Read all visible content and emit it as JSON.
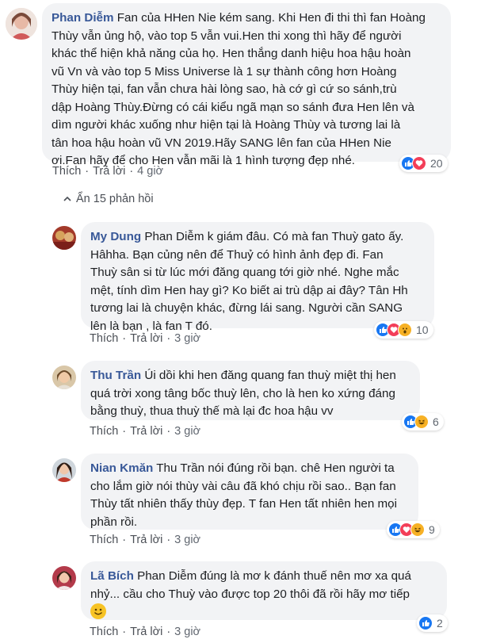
{
  "comments": [
    {
      "author": "Phan Diễm",
      "lines": [
        "Fan của HHen Nie kém sang. Khi Hen đi thi thì fan Hoàng",
        "Thùy vẫn ủng hộ, vào top 5 vẫn vui.Hen thi xong thì hãy để người",
        "khác thể hiện khả năng của họ. Hen thắng danh hiệu hoa hậu hoàn",
        "vũ Vn và vào top 5 Miss Universe là 1 sự thành công hơn Hoàng",
        "Thùy hiện tại, fan vẫn chưa hài lòng sao, hà cớ gì cứ so sánh,trù",
        "dập Hoàng Thùy.Đừng có cái kiểu ngã mạn so sánh đưa Hen lên và",
        "dìm người khác xuống như hiện tại là Hoàng Thùy và tương lai là",
        "tân hoa hậu hoàn vũ VN 2019.Hãy SANG lên fan của HHen Nie",
        "ơi.Fan hãy để cho Hen vẫn mãi là 1 hình tượng đẹp nhé."
      ],
      "like": "Thích",
      "reply": "Trả lời",
      "time": "4 giờ",
      "reaction_count": "20"
    }
  ],
  "replies_toggle": "Ẩn 15 phản hồi",
  "replies": [
    {
      "author": "My Dung",
      "lines": [
        "Phan Diễm k giám đâu. Có mà fan Thuỳ gato ấy.",
        "Hâhha. Bạn củng nên để Thuỷ có hình ảnh đẹp đi. Fan",
        "Thuỳ sân si từ lúc mới đăng quang tới giờ nhé. Nghe mắc",
        "mệt, tính dìm Hen hay gì? Ko biết ai trù dập ai đây? Tân Hh",
        "tương lai là chuyện khác, đừng lái sang. Người cần SANG",
        "lên là bạn , là fan T đó."
      ],
      "like": "Thích",
      "reply": "Trả lời",
      "time": "3 giờ",
      "reaction_count": "10"
    },
    {
      "author": "Thu Trần",
      "lines": [
        "Úi dồi khi hen đăng quang fan thuỳ miệt thị hen",
        "quá trời xong tâng bốc thuỳ lên, cho là hen ko xứng đáng",
        "bằng thuỳ, thua thuỳ thế mà lại đc hoa hậu vv"
      ],
      "like": "Thích",
      "reply": "Trả lời",
      "time": "3 giờ",
      "reaction_count": "6"
    },
    {
      "author": "Nian Kmăn",
      "lines": [
        "Thu Trần nói đúng rồi bạn. chê Hen người ta",
        "cho lắm giờ nói thùy vài câu đã khó chịu rồi sao.. Bạn fan",
        "Thùy tất nhiên thấy thùy đẹp. T fan Hen tất nhiên hen mọi",
        "phần rồi."
      ],
      "like": "Thích",
      "reply": "Trả lời",
      "time": "3 giờ",
      "reaction_count": "9"
    },
    {
      "author": "Lã Bích",
      "lines": [
        "Phan Diễm đúng là mơ k đánh thuế nên mơ xa quá",
        "nhỷ... cầu cho Thuỳ vào được top 20 thôi đã rồi hãy mơ tiếp"
      ],
      "like": "Thích",
      "reply": "Trả lời",
      "time": "3 giờ",
      "reaction_count": "2"
    }
  ]
}
